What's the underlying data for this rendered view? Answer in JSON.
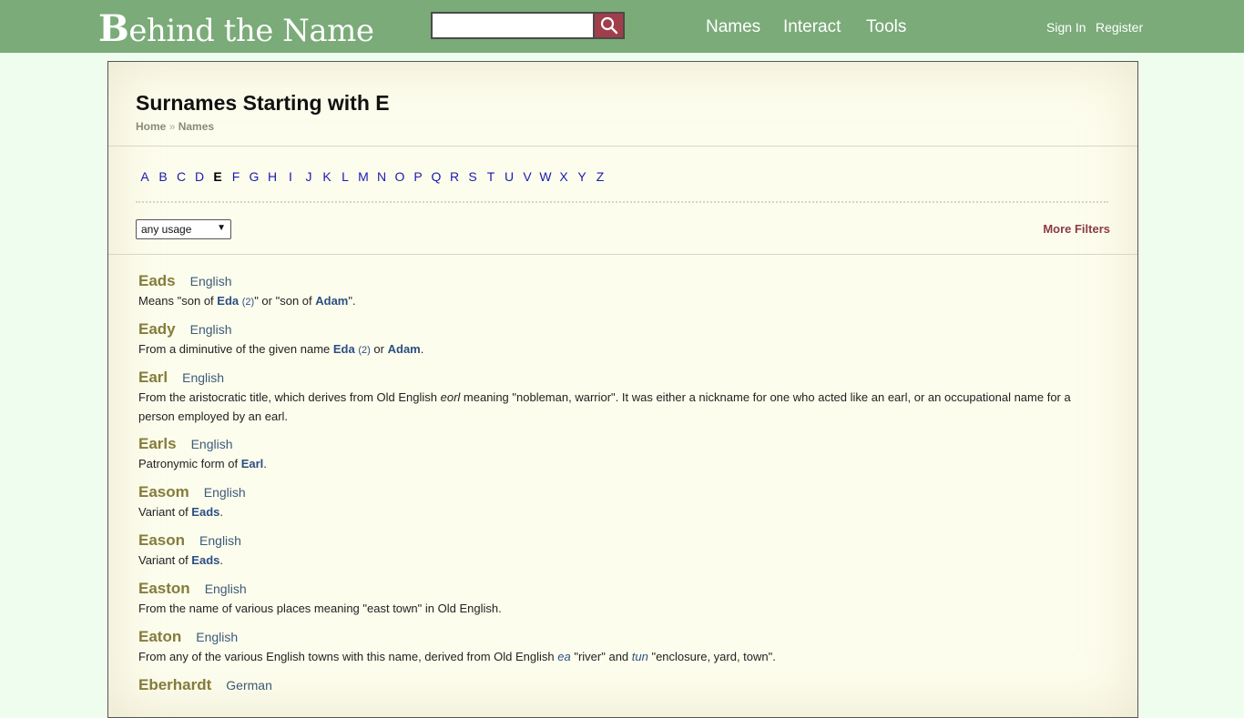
{
  "header": {
    "logo_b": "B",
    "logo_rest": "ehind the Name",
    "search_placeholder": "",
    "nav": [
      "Names",
      "Interact",
      "Tools"
    ],
    "sign_in": "Sign In",
    "register": "Register",
    "colors": {
      "bar": "#7aab78",
      "search_button": "#a03e4b"
    }
  },
  "page": {
    "title": "Surnames Starting with E",
    "breadcrumb": [
      "Home",
      "Names"
    ],
    "breadcrumb_sep": "»",
    "letters": [
      "A",
      "B",
      "C",
      "D",
      "E",
      "F",
      "G",
      "H",
      "I",
      "J",
      "K",
      "L",
      "M",
      "N",
      "O",
      "P",
      "Q",
      "R",
      "S",
      "T",
      "U",
      "V",
      "W",
      "X",
      "Y",
      "Z"
    ],
    "current_letter": "E",
    "usage_select": "any usage",
    "more_filters": "More Filters"
  },
  "entries": [
    {
      "name": "Eads",
      "usage": "English",
      "desc": [
        "Means \"son of ",
        {
          "link": "Eda"
        },
        " ",
        {
          "sup": "(2)"
        },
        "\" or \"son of ",
        {
          "link": "Adam"
        },
        "\"."
      ]
    },
    {
      "name": "Eady",
      "usage": "English",
      "desc": [
        "From a diminutive of the given name ",
        {
          "link": "Eda"
        },
        " ",
        {
          "sup": "(2)"
        },
        " or ",
        {
          "link": "Adam"
        },
        "."
      ]
    },
    {
      "name": "Earl",
      "usage": "English",
      "desc": [
        "From the aristocratic title, which derives from Old English ",
        {
          "italic": "eorl"
        },
        " meaning \"nobleman, warrior\". It was either a nickname for one who acted like an earl, or an occupational name for a person employed by an earl."
      ]
    },
    {
      "name": "Earls",
      "usage": "English",
      "desc": [
        "Patronymic form of ",
        {
          "link": "Earl"
        },
        "."
      ]
    },
    {
      "name": "Easom",
      "usage": "English",
      "desc": [
        "Variant of ",
        {
          "link": "Eads"
        },
        "."
      ]
    },
    {
      "name": "Eason",
      "usage": "English",
      "desc": [
        "Variant of ",
        {
          "link": "Eads"
        },
        "."
      ]
    },
    {
      "name": "Easton",
      "usage": "English",
      "desc": [
        "From the name of various places meaning \"east town\" in Old English."
      ]
    },
    {
      "name": "Eaton",
      "usage": "English",
      "desc": [
        "From any of the various English towns with this name, derived from Old English ",
        {
          "italink": "ea"
        },
        " \"river\" and ",
        {
          "italink": "tun"
        },
        " \"enclosure, yard, town\"."
      ]
    },
    {
      "name": "Eberhardt",
      "usage": "German",
      "desc": []
    }
  ]
}
